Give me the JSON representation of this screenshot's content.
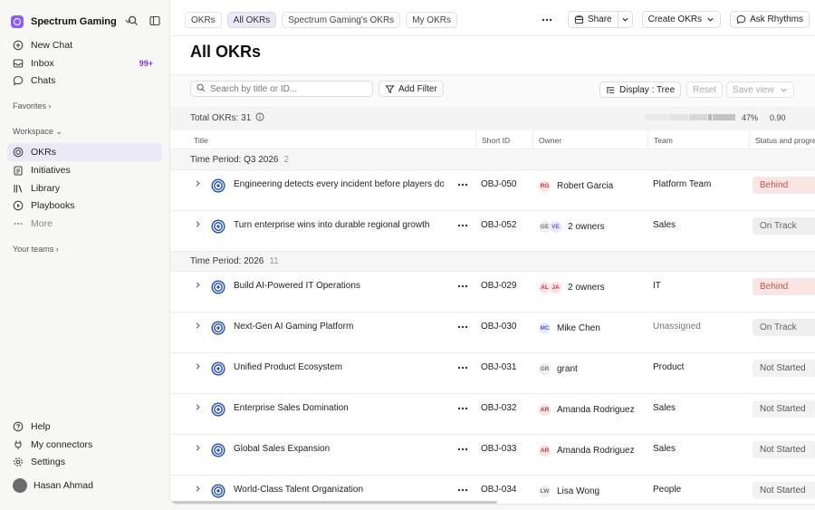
{
  "workspace": {
    "name": "Spectrum Gaming"
  },
  "nav": {
    "new_chat": "New Chat",
    "inbox": "Inbox",
    "inbox_badge": "99+",
    "chats": "Chats",
    "favorites": "Favorites",
    "workspace": "Workspace",
    "okrs": "OKRs",
    "initiatives": "Initiatives",
    "library": "Library",
    "playbooks": "Playbooks",
    "more": "More",
    "your_teams": "Your teams",
    "help": "Help",
    "connectors": "My connectors",
    "settings": "Settings",
    "user": "Hasan Ahmad"
  },
  "tabs": [
    "OKRs",
    "All OKRs",
    "Spectrum Gaming's OKRs",
    "My OKRs"
  ],
  "actions": {
    "share": "Share",
    "create": "Create OKRs",
    "ask": "Ask Rhythms"
  },
  "page": {
    "title": "All OKRs"
  },
  "toolbar": {
    "search_placeholder": "Search by title or ID...",
    "add_filter": "Add Filter",
    "display": "Display : Tree",
    "reset": "Reset",
    "save_view": "Save view"
  },
  "summary": {
    "total": "Total OKRs: 31",
    "percent": "47%",
    "score": "0.90"
  },
  "columns": {
    "title": "Title",
    "short_id": "Short ID",
    "owner": "Owner",
    "team": "Team",
    "status": "Status and progre"
  },
  "groups": [
    {
      "label": "Time Period: Q3 2026",
      "count": "2"
    },
    {
      "label": "Time Period: 2026",
      "count": "11"
    }
  ],
  "rows": [
    {
      "title": "Engineering detects every incident before players do",
      "id": "OBJ-050",
      "owners": [
        {
          "i": "RG",
          "bg": "#fde3e3",
          "fg": "#c03a3a"
        }
      ],
      "owner_name": "Robert Garcia",
      "team": "Platform Team",
      "status": "Behind"
    },
    {
      "title": "Turn enterprise wins into durable regional growth",
      "id": "OBJ-052",
      "owners": [
        {
          "i": "GE",
          "bg": "#eeeeee",
          "fg": "#777777"
        },
        {
          "i": "VE",
          "bg": "#ece7fb",
          "fg": "#7c5bd6"
        }
      ],
      "owner_name": "2 owners",
      "team": "Sales",
      "status": "On Track"
    },
    {
      "title": "Build AI-Powered IT Operations",
      "id": "OBJ-029",
      "owners": [
        {
          "i": "AL",
          "bg": "#fde3e3",
          "fg": "#c03a3a"
        },
        {
          "i": "JA",
          "bg": "#fde3e3",
          "fg": "#c03a3a"
        }
      ],
      "owner_name": "2 owners",
      "team": "IT",
      "status": "Behind"
    },
    {
      "title": "Next-Gen AI Gaming Platform",
      "id": "OBJ-030",
      "owners": [
        {
          "i": "MC",
          "bg": "#e6ecfb",
          "fg": "#4a63c9"
        }
      ],
      "owner_name": "Mike Chen",
      "team": "Unassigned",
      "status": "On Track"
    },
    {
      "title": "Unified Product Ecosystem",
      "id": "OBJ-031",
      "owners": [
        {
          "i": "GR",
          "bg": "#eeeeee",
          "fg": "#777777"
        }
      ],
      "owner_name": "grant",
      "team": "Product",
      "status": "Not Started"
    },
    {
      "title": "Enterprise Sales Domination",
      "id": "OBJ-032",
      "owners": [
        {
          "i": "AR",
          "bg": "#fde3e3",
          "fg": "#c03a3a"
        }
      ],
      "owner_name": "Amanda Rodriguez",
      "team": "Sales",
      "status": "Not Started"
    },
    {
      "title": "Global Sales Expansion",
      "id": "OBJ-033",
      "owners": [
        {
          "i": "AR",
          "bg": "#fde3e3",
          "fg": "#c03a3a"
        }
      ],
      "owner_name": "Amanda Rodriguez",
      "team": "Sales",
      "status": "Not Started"
    },
    {
      "title": "World-Class Talent Organization",
      "id": "OBJ-034",
      "owners": [
        {
          "i": "LW",
          "bg": "#eeeeee",
          "fg": "#777777"
        }
      ],
      "owner_name": "Lisa Wong",
      "team": "People",
      "status": "Not Started"
    }
  ],
  "status_colors": {
    "Behind": {
      "bg": "#f9e6e4",
      "fg": "#c4554a"
    },
    "On Track": {
      "bg": "#eeeeee",
      "fg": "#666666"
    },
    "Not Started": {
      "bg": "#f2f2f2",
      "fg": "#555555"
    }
  }
}
